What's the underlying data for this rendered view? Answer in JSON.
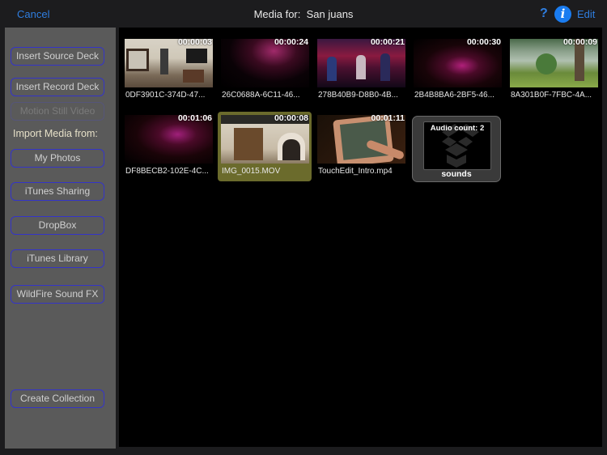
{
  "topbar": {
    "cancel_label": "Cancel",
    "title_prefix": "Media for:",
    "title_project": "San juans",
    "help_label": "?",
    "info_label": "i",
    "edit_label": "Edit",
    "accent_color": "#2f7ee0"
  },
  "sidebar": {
    "insert_source_label": "Insert Source Deck",
    "insert_record_label": "Insert Record Deck",
    "motion_still_label": "Motion Still Video",
    "import_label": "Import Media from:",
    "sources": [
      {
        "label": "My Photos"
      },
      {
        "label": "iTunes Sharing"
      },
      {
        "label": "DropBox"
      },
      {
        "label": "iTunes Library"
      },
      {
        "label": "WildFire Sound FX"
      }
    ],
    "create_collection_label": "Create Collection"
  },
  "media": [
    {
      "name": "0DF3901C-374D-47...",
      "duration": "00:00:03",
      "scene": "living-room",
      "selected": false
    },
    {
      "name": "26C0688A-6C11-46...",
      "duration": "00:00:24",
      "scene": "dark-concert",
      "selected": false
    },
    {
      "name": "278B40B9-D8B0-4B...",
      "duration": "00:00:21",
      "scene": "band-stage",
      "selected": false
    },
    {
      "name": "2B4B8BA6-2BF5-46...",
      "duration": "00:00:30",
      "scene": "dark-concert",
      "selected": false
    },
    {
      "name": "8A301B0F-7FBC-4A...",
      "duration": "00:00:09",
      "scene": "lakeside",
      "selected": false
    },
    {
      "name": "DF8BECB2-102E-4C...",
      "duration": "00:01:06",
      "scene": "dark-concert",
      "selected": false
    },
    {
      "name": "IMG_0015.MOV",
      "duration": "00:00:08",
      "scene": "fireplace-room",
      "selected": true
    },
    {
      "name": "TouchEdit_Intro.mp4",
      "duration": "00:01:11",
      "scene": "tablet-hand",
      "selected": false
    }
  ],
  "folder": {
    "count_label": "Audio count: 2",
    "name": "sounds",
    "icon": "dropbox-icon"
  }
}
